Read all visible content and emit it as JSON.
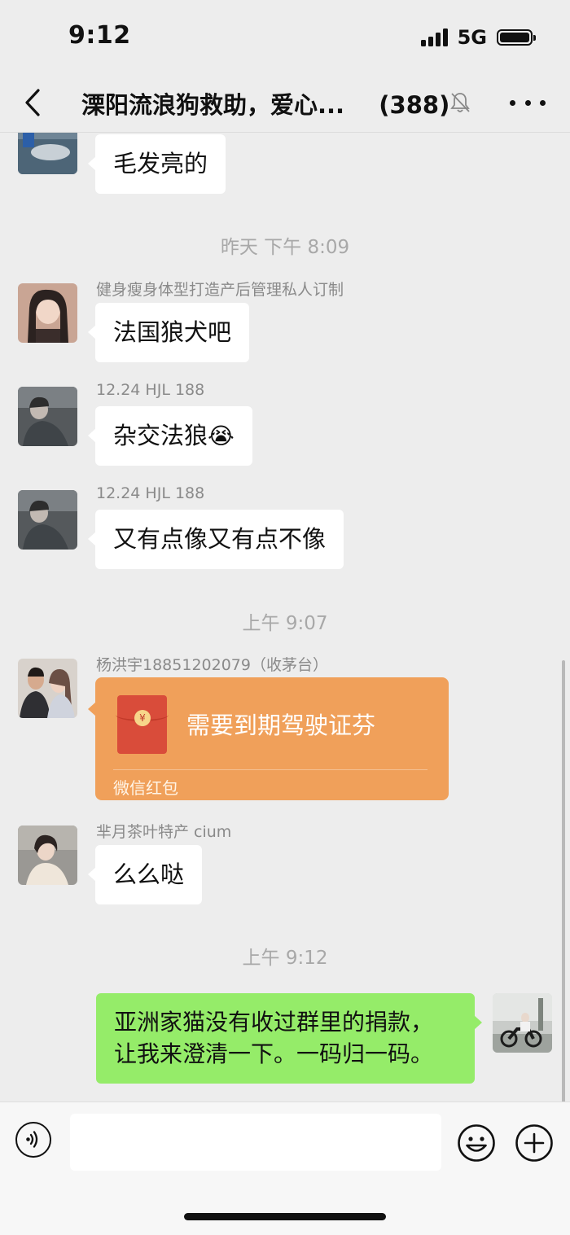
{
  "status_bar": {
    "time": "9:12",
    "network": "5G"
  },
  "header": {
    "title": "溧阳流浪狗救助，爱心...",
    "member_count": "(388)"
  },
  "messages": [
    {
      "type": "text",
      "sender": "",
      "text": "毛发亮的"
    },
    {
      "type": "time",
      "text": "昨天 下午 8:09"
    },
    {
      "type": "text",
      "sender": "健身瘦身体型打造产后管理私人订制",
      "text": "法国狼犬吧"
    },
    {
      "type": "text",
      "sender": "12.24 HJL 188",
      "text": "杂交法狼",
      "emoji": "😭"
    },
    {
      "type": "text",
      "sender": "12.24 HJL 188",
      "text": "又有点像又有点不像"
    },
    {
      "type": "time",
      "text": "上午 9:07"
    },
    {
      "type": "red_packet",
      "sender": "杨洪宇18851202079（收茅台）",
      "title": "需要到期驾驶证芬",
      "footer": "微信红包"
    },
    {
      "type": "text",
      "sender": "芈月茶叶特产 cium",
      "text": "么么哒"
    },
    {
      "type": "time",
      "text": "上午 9:12"
    },
    {
      "type": "self_text",
      "lines": [
        "亚洲家猫没有收过群里的捐款，",
        "让我来澄清一下。一码归一码。"
      ]
    }
  ],
  "colors": {
    "background": "#ededed",
    "self_bubble": "#95ec69",
    "red_packet": "#f0a05a",
    "timestamp": "#a8a8a8"
  },
  "icons": [
    "back-icon",
    "mute-bell-icon",
    "more-icon",
    "voice-icon",
    "emoji-icon",
    "plus-icon"
  ]
}
